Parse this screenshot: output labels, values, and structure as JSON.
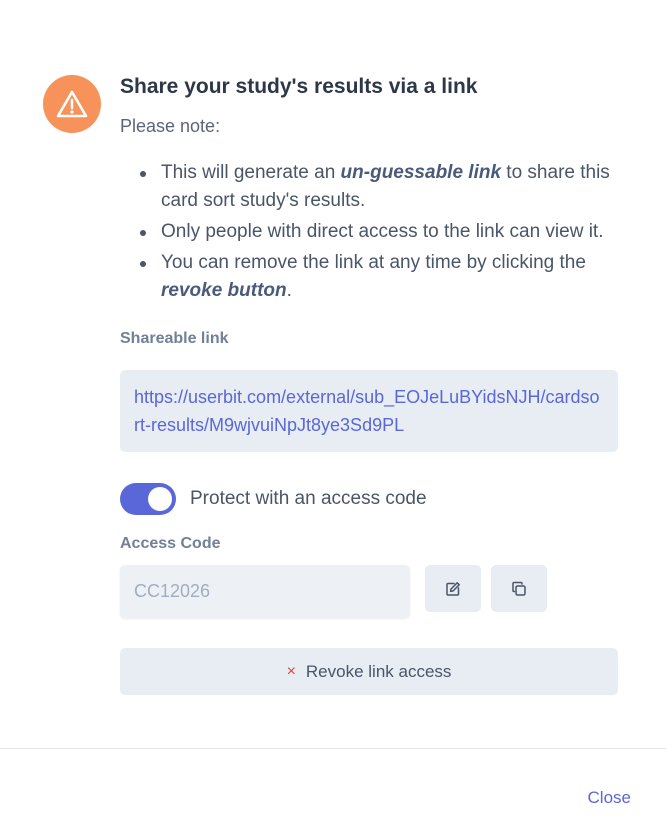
{
  "dialog": {
    "title": "Share your study's results via a link",
    "note": "Please note:",
    "bullets": [
      {
        "before": "This will generate an ",
        "emphasis": "un-guessable link",
        "after": " to share this card sort study's results."
      },
      {
        "before": "Only people with direct access to the link can view it.",
        "emphasis": "",
        "after": ""
      },
      {
        "before": "You can remove the link at any time by clicking the ",
        "emphasis": "revoke button",
        "after": "."
      }
    ],
    "shareable_label": "Shareable link",
    "link": "https://userbit.com/external/sub_EOJeLuBYidsNJH/cardsort-results/M9wjvuiNpJt8ye3Sd9PL",
    "toggle": {
      "label": "Protect with an access code",
      "enabled": true
    },
    "access_code_label": "Access Code",
    "access_code_placeholder": "CC12026",
    "revoke_label": "Revoke link access",
    "revoke_icon": "×",
    "close_label": "Close",
    "icons": {
      "warning": "warning-triangle-icon",
      "edit": "edit-icon",
      "copy": "copy-icon",
      "revoke": "close-icon"
    },
    "colors": {
      "accent": "#5a67d8",
      "warning": "#f6925a",
      "danger": "#e53e3e"
    }
  }
}
